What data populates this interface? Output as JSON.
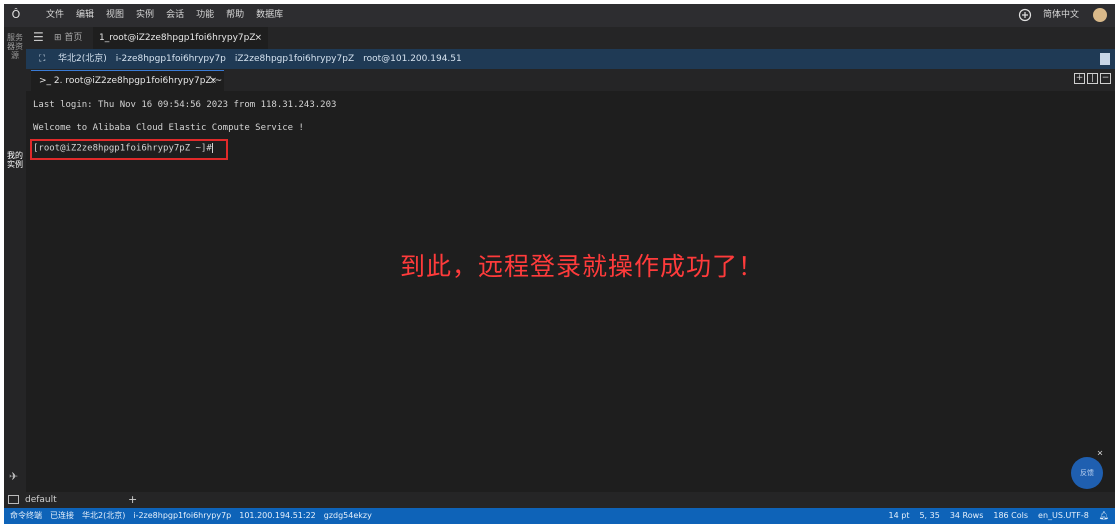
{
  "menubar": {
    "menus": [
      "文件",
      "编辑",
      "视图",
      "实例",
      "会话",
      "功能",
      "帮助",
      "数据库"
    ],
    "language": "简体中文"
  },
  "activity": {
    "item1": "服务器资源",
    "item2": "我的实例"
  },
  "tabs": {
    "home_label": "首页",
    "session_tab": "1_root@iZ2ze8hpgp1foi6hrypy7pZ",
    "close": "×"
  },
  "infobar": {
    "items": [
      "华北2(北京)",
      "i-2ze8hpgp1foi6hrypy7p",
      "iZ2ze8hpgp1foi6hrypy7pZ",
      "root@101.200.194.51"
    ]
  },
  "terminal_tab": {
    "label": ">_ 2. root@iZ2ze8hpgp1foi6hrypy7pZ:~",
    "close": "×"
  },
  "terminal": {
    "line1": "Last login: Thu Nov 16 09:54:56 2023 from 118.31.243.203",
    "line2": "Welcome to Alibaba Cloud Elastic Compute Service !",
    "prompt": "[root@iZ2ze8hpgp1foi6hrypy7pZ ~]#"
  },
  "annotation": "到此，远程登录就操作成功了！",
  "chat": {
    "label": "反馈",
    "close": "×"
  },
  "panel": {
    "tab_label": "default",
    "add": "+"
  },
  "statusbar": {
    "left": [
      "命令终端",
      "已连接",
      "华北2(北京)",
      "i-2ze8hpgp1foi6hrypy7p",
      "101.200.194.51:22",
      "gzdg54ekzy"
    ],
    "right": [
      "14 pt",
      "5, 35",
      "34 Rows",
      "186 Cols",
      "en_US.UTF-8"
    ]
  },
  "colors": {
    "accent": "#0e63b8",
    "highlight": "#e02a2a",
    "annotation": "#ff3b3b"
  }
}
